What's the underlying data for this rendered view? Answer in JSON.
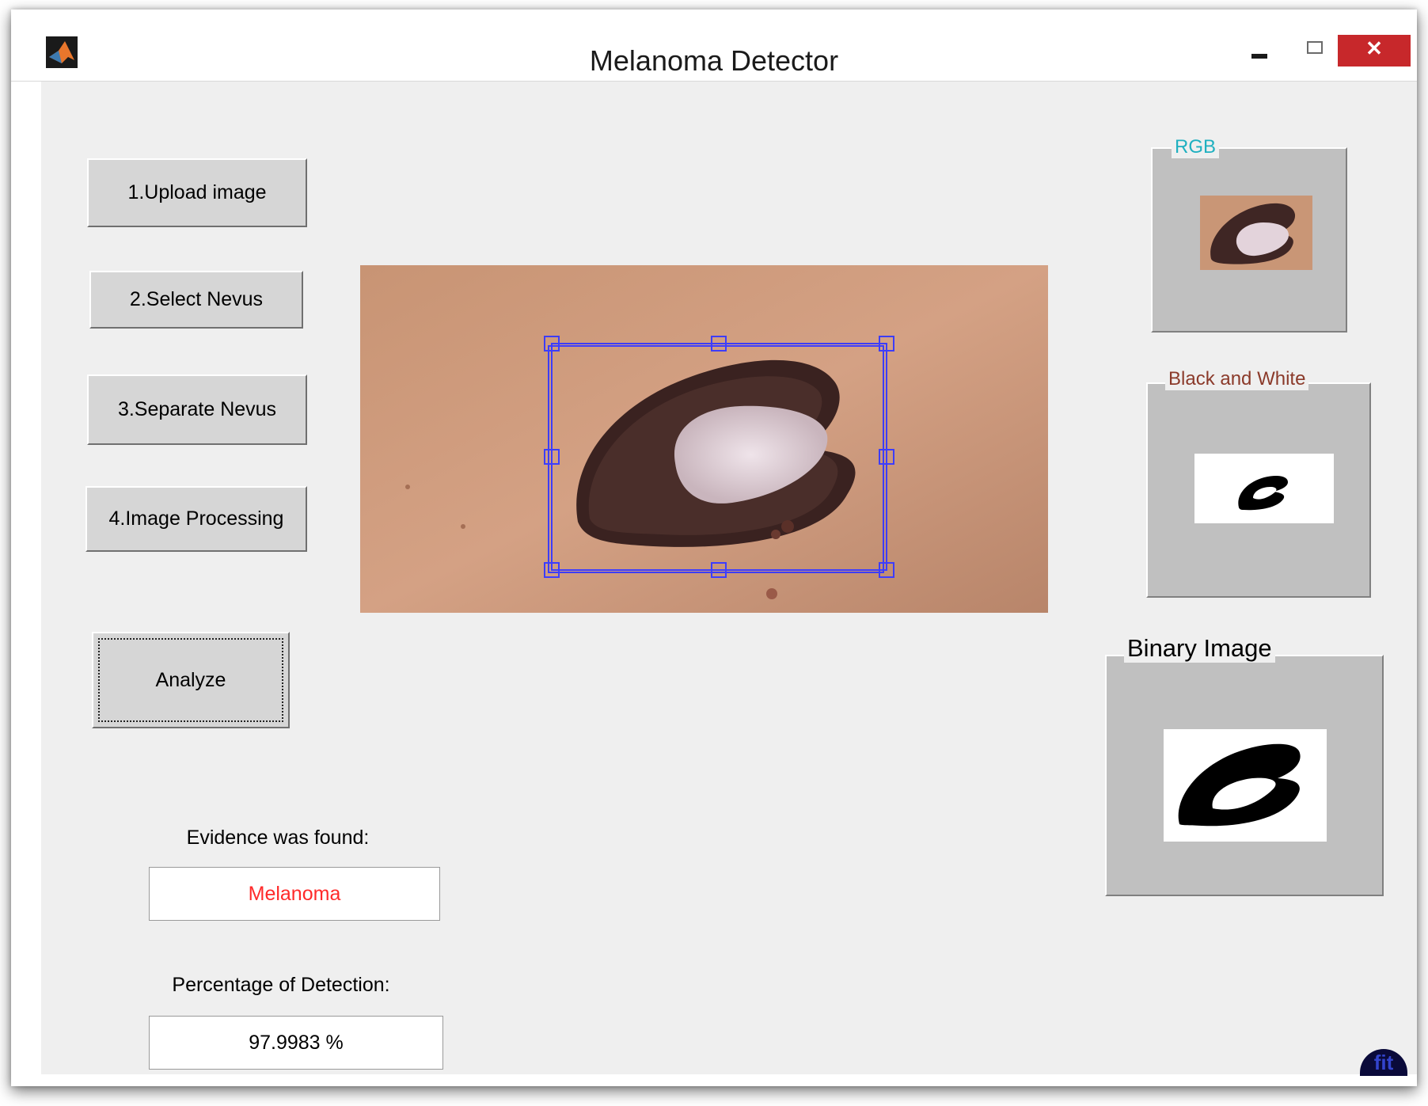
{
  "window": {
    "title": "Melanoma  Detector",
    "close_glyph": "✕"
  },
  "buttons": {
    "upload": "1.Upload image",
    "select": "2.Select Nevus",
    "separate": "3.Separate Nevus",
    "processing": "4.Image Processing",
    "analyze": "Analyze"
  },
  "results": {
    "evidence_label": "Evidence was found:",
    "evidence_value": "Melanoma",
    "evidence_color": "#ff2a2a",
    "percentage_label": "Percentage of Detection:",
    "percentage_value": "97.9983 %"
  },
  "panels": {
    "rgb_title": "RGB",
    "rgb_title_color": "#1fb0c0",
    "bw_title": "Black and White",
    "bw_title_color": "#8b3a2a",
    "binary_title": "Binary Image",
    "binary_title_color": "#000000"
  },
  "icons": {
    "app": "matlab-icon",
    "logo": "fit-logo-icon"
  },
  "colors": {
    "selection": "#3d3dff",
    "panel_bg": "#c0c0c0",
    "client_bg": "#efefef"
  }
}
